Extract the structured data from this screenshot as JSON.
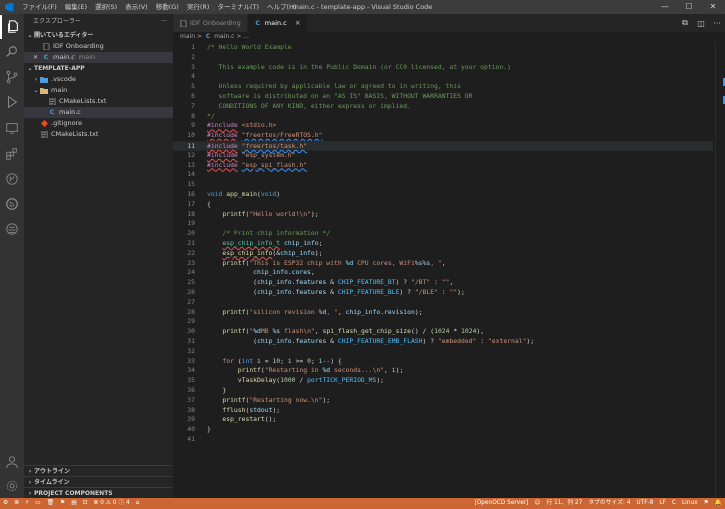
{
  "window": {
    "title": "main.c - template-app - Visual Studio Code",
    "menu": [
      "ファイル(F)",
      "編集(E)",
      "選択(S)",
      "表示(V)",
      "移動(G)",
      "実行(R)",
      "ターミナル(T)",
      "ヘルプ(H)"
    ],
    "controls": [
      "—",
      "☐",
      "✕"
    ]
  },
  "activity": [
    "files-icon",
    "search-icon",
    "source-control-icon",
    "run-debug-icon",
    "remote-explorer-icon",
    "extensions-icon",
    "git-graph-icon",
    "espressif-icon",
    "platformio-icon"
  ],
  "sidebar": {
    "title": "エクスプローラー",
    "more": "···",
    "open_editors_header": "開いているエディター",
    "open_editors": [
      {
        "label": "IDF Onboarding",
        "prefix": ""
      },
      {
        "label": "main.c",
        "sub": "main",
        "prefix": "✕"
      }
    ],
    "project_header": "TEMPLATE-APP",
    "tree": [
      {
        "label": ".vscode",
        "kind": "folder-closed",
        "indent": 1
      },
      {
        "label": "main",
        "kind": "folder-open",
        "indent": 1
      },
      {
        "label": "CMakeLists.txt",
        "kind": "txt",
        "indent": 2
      },
      {
        "label": "main.c",
        "kind": "c",
        "indent": 2
      },
      {
        "label": ".gitignore",
        "kind": "git",
        "indent": 1
      },
      {
        "label": "CMakeLists.txt",
        "kind": "txt",
        "indent": 1
      }
    ],
    "bottom_sections": [
      "アウトライン",
      "タイムライン",
      "PROJECT COMPONENTS"
    ]
  },
  "tabs": [
    {
      "label": "IDF Onboarding",
      "active": false
    },
    {
      "label": "main.c",
      "active": true,
      "close": "×"
    }
  ],
  "editor_actions": [
    "⧉",
    "◫",
    "···"
  ],
  "breadcrumb": {
    "folder": "main",
    "sep": ">",
    "icon": "C",
    "file": "main.c",
    "tail": "> ..."
  },
  "editor": {
    "current_line": 11,
    "lines": [
      [
        [
          "t-comment",
          "/* Hello World Example"
        ]
      ],
      [],
      [
        [
          "t-comment",
          "   This example code is in the Public Domain (or CC0 licensed, at your option.)"
        ]
      ],
      [],
      [
        [
          "t-comment",
          "   Unless required by applicable law or agreed to in writing, this"
        ]
      ],
      [
        [
          "t-comment",
          "   software is distributed on an \"AS IS\" BASIS, WITHOUT WARRANTIES OR"
        ]
      ],
      [
        [
          "t-comment",
          "   CONDITIONS OF ANY KIND, either express or implied."
        ]
      ],
      [
        [
          "t-comment",
          "*/"
        ]
      ],
      [
        [
          "t-pre squig",
          "#include"
        ],
        [
          "",
          " "
        ],
        [
          "t-str",
          "<stdio.h>"
        ]
      ],
      [
        [
          "t-pre squig",
          "#include"
        ],
        [
          "",
          " "
        ],
        [
          "t-str squig-b",
          "\"freertos/FreeRTOS.h\""
        ]
      ],
      [
        [
          "t-pre squig",
          "#include"
        ],
        [
          "",
          " "
        ],
        [
          "t-str squig-b",
          "\"freertos/task.h\""
        ]
      ],
      [
        [
          "t-pre squig",
          "#include"
        ],
        [
          "",
          " "
        ],
        [
          "t-str",
          "\"esp_system.h\""
        ]
      ],
      [
        [
          "t-pre squig",
          "#include"
        ],
        [
          "",
          " "
        ],
        [
          "t-str squig-b",
          "\"esp_spi_flash.h\""
        ]
      ],
      [],
      [],
      [
        [
          "t-kw",
          "void"
        ],
        [
          "",
          " "
        ],
        [
          "t-fn",
          "app_main"
        ],
        [
          "",
          "("
        ],
        [
          "t-kw",
          "void"
        ],
        [
          "",
          ")"
        ]
      ],
      [
        [
          "",
          "{"
        ]
      ],
      [
        [
          "",
          "    "
        ],
        [
          "t-fn",
          "printf"
        ],
        [
          "",
          "("
        ],
        [
          "t-str",
          "\"Hello world!\\n\""
        ],
        [
          "",
          ");"
        ]
      ],
      [],
      [
        [
          "",
          "    "
        ],
        [
          "t-comment",
          "/* Print chip information */"
        ]
      ],
      [
        [
          "",
          "    "
        ],
        [
          "t-type squig",
          "esp_chip_info_t"
        ],
        [
          "",
          " "
        ],
        [
          "t-var",
          "chip_info"
        ],
        [
          "",
          ";"
        ]
      ],
      [
        [
          "",
          "    "
        ],
        [
          "t-fn squig",
          "esp_chip_info"
        ],
        [
          "",
          "(&"
        ],
        [
          "t-var",
          "chip_info"
        ],
        [
          "",
          ");"
        ]
      ],
      [
        [
          "",
          "    "
        ],
        [
          "t-fn",
          "printf"
        ],
        [
          "",
          "("
        ],
        [
          "t-str",
          "\"This is ESP32 chip with "
        ],
        [
          "t-var",
          "%d"
        ],
        [
          "t-str",
          " CPU cores, WiFi"
        ],
        [
          "t-var",
          "%s%s"
        ],
        [
          "t-str",
          ", \""
        ],
        [
          "",
          ","
        ]
      ],
      [
        [
          "",
          "            "
        ],
        [
          "t-var",
          "chip_info"
        ],
        [
          "",
          "."
        ],
        [
          "t-var",
          "cores"
        ],
        [
          "",
          ","
        ]
      ],
      [
        [
          "",
          "            ("
        ],
        [
          "t-var",
          "chip_info"
        ],
        [
          "",
          "."
        ],
        [
          "t-var",
          "features"
        ],
        [
          "",
          " & "
        ],
        [
          "t-const",
          "CHIP_FEATURE_BT"
        ],
        [
          "",
          ") ? "
        ],
        [
          "t-str",
          "\"/BT\""
        ],
        [
          "",
          " : "
        ],
        [
          "t-str",
          "\"\""
        ],
        [
          "",
          ","
        ]
      ],
      [
        [
          "",
          "            ("
        ],
        [
          "t-var",
          "chip_info"
        ],
        [
          "",
          "."
        ],
        [
          "t-var",
          "features"
        ],
        [
          "",
          " & "
        ],
        [
          "t-const",
          "CHIP_FEATURE_BLE"
        ],
        [
          "",
          ") ? "
        ],
        [
          "t-str",
          "\"/BLE\""
        ],
        [
          "",
          " : "
        ],
        [
          "t-str",
          "\"\""
        ],
        [
          "",
          ");"
        ]
      ],
      [],
      [
        [
          "",
          "    "
        ],
        [
          "t-fn",
          "printf"
        ],
        [
          "",
          "("
        ],
        [
          "t-str",
          "\"silicon revision "
        ],
        [
          "t-var",
          "%d"
        ],
        [
          "t-str",
          ", \""
        ],
        [
          "",
          ", "
        ],
        [
          "t-var",
          "chip_info"
        ],
        [
          "",
          "."
        ],
        [
          "t-var",
          "revision"
        ],
        [
          "",
          ");"
        ]
      ],
      [],
      [
        [
          "",
          "    "
        ],
        [
          "t-fn",
          "printf"
        ],
        [
          "",
          "("
        ],
        [
          "t-str",
          "\""
        ],
        [
          "t-var",
          "%d"
        ],
        [
          "t-str",
          "MB "
        ],
        [
          "t-var",
          "%s"
        ],
        [
          "t-str",
          " flash\\n\""
        ],
        [
          "",
          ", "
        ],
        [
          "t-fn",
          "spi_flash_get_chip_size"
        ],
        [
          "",
          "() / ("
        ],
        [
          "t-num",
          "1024"
        ],
        [
          "",
          " * "
        ],
        [
          "t-num",
          "1024"
        ],
        [
          "",
          "),"
        ]
      ],
      [
        [
          "",
          "            ("
        ],
        [
          "t-var",
          "chip_info"
        ],
        [
          "",
          "."
        ],
        [
          "t-var",
          "features"
        ],
        [
          "",
          " & "
        ],
        [
          "t-const",
          "CHIP_FEATURE_EMB_FLASH"
        ],
        [
          "",
          ") ? "
        ],
        [
          "t-str",
          "\"embedded\""
        ],
        [
          "",
          " : "
        ],
        [
          "t-str",
          "\"external\""
        ],
        [
          "",
          ");"
        ]
      ],
      [],
      [
        [
          "",
          "    "
        ],
        [
          "t-ctl",
          "for"
        ],
        [
          "",
          " ("
        ],
        [
          "t-kw",
          "int"
        ],
        [
          "",
          " "
        ],
        [
          "t-var",
          "i"
        ],
        [
          "",
          " = "
        ],
        [
          "t-num",
          "10"
        ],
        [
          "",
          "; "
        ],
        [
          "t-var",
          "i"
        ],
        [
          "",
          " >= "
        ],
        [
          "t-num",
          "0"
        ],
        [
          "",
          "; "
        ],
        [
          "t-var",
          "i"
        ],
        [
          "",
          "--) {"
        ]
      ],
      [
        [
          "",
          "        "
        ],
        [
          "t-fn",
          "printf"
        ],
        [
          "",
          "("
        ],
        [
          "t-str",
          "\"Restarting in "
        ],
        [
          "t-var",
          "%d"
        ],
        [
          "t-str",
          " seconds...\\n\""
        ],
        [
          "",
          ", "
        ],
        [
          "t-var",
          "i"
        ],
        [
          "",
          ");"
        ]
      ],
      [
        [
          "",
          "        "
        ],
        [
          "t-fn",
          "vTaskDelay"
        ],
        [
          "",
          "("
        ],
        [
          "t-num",
          "1000"
        ],
        [
          "",
          " / "
        ],
        [
          "t-const",
          "portTICK_PERIOD_MS"
        ],
        [
          "",
          ");"
        ]
      ],
      [
        [
          "",
          "    }"
        ]
      ],
      [
        [
          "",
          "    "
        ],
        [
          "t-fn",
          "printf"
        ],
        [
          "",
          "("
        ],
        [
          "t-str",
          "\"Restarting now.\\n\""
        ],
        [
          "",
          ");"
        ]
      ],
      [
        [
          "",
          "    "
        ],
        [
          "t-fn",
          "fflush"
        ],
        [
          "",
          "("
        ],
        [
          "t-var",
          "stdout"
        ],
        [
          "",
          ");"
        ]
      ],
      [
        [
          "",
          "    "
        ],
        [
          "t-fn",
          "esp_restart"
        ],
        [
          "",
          "();"
        ]
      ],
      [
        [
          "",
          "}"
        ]
      ],
      []
    ]
  },
  "statusbar": {
    "left": [
      "⚙",
      "⊗",
      "⚡",
      "▭",
      "🗑",
      "⚑",
      "▤",
      "⊡",
      "⊗ 0 ⚠ 0 ⓘ 4",
      "⌂"
    ],
    "right": [
      "[OpenOCD Server]",
      "☺",
      "行 11、列 27",
      "タブのサイズ: 4",
      "UTF-8",
      "LF",
      "C",
      "Linux",
      "⚑",
      "🔔"
    ]
  },
  "colors": {
    "statusbar": "#cc6633",
    "accent": "#0078d4"
  }
}
